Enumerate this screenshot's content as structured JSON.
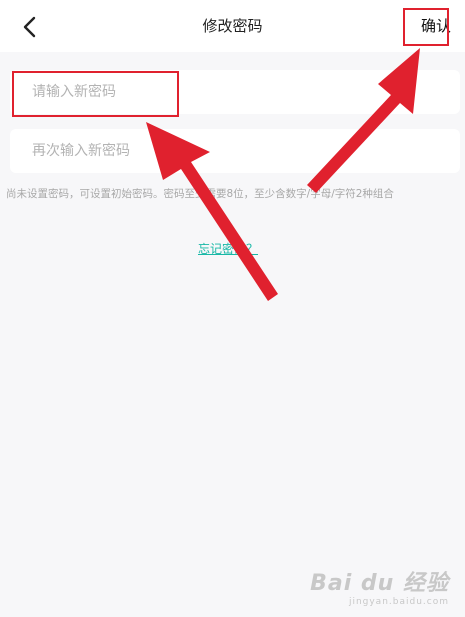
{
  "header": {
    "title": "修改密码",
    "confirm_label": "确认"
  },
  "form": {
    "new_password_placeholder": "请输入新密码",
    "confirm_password_placeholder": "再次输入新密码",
    "hint": "尚未设置密码，可设置初始密码。密码至少需要8位，至少含数字/字母/字符2种组合",
    "forgot_link": "忘记密码？"
  },
  "annotations": {
    "color": "#e0212e"
  },
  "watermark": {
    "main": "Bai du 经验",
    "sub": "jingyan.baidu.com"
  },
  "icons": {
    "back": "chevron-left-icon"
  }
}
